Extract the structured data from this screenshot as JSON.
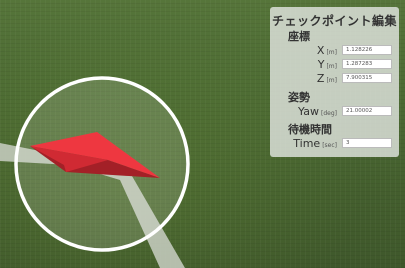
{
  "panel": {
    "title": "チェックポイント編集",
    "position_section": "座標",
    "x": {
      "label": "X",
      "unit": "[m]",
      "value": "1.128226"
    },
    "y": {
      "label": "Y",
      "unit": "[m]",
      "value": "1.287283"
    },
    "z": {
      "label": "Z",
      "unit": "[m]",
      "value": "7.900315"
    },
    "attitude_section": "姿勢",
    "yaw": {
      "label": "Yaw",
      "unit": "[deg]",
      "value": "21.00002"
    },
    "wait_section": "待機時間",
    "time": {
      "label": "Time",
      "unit": "[sec]",
      "value": "3"
    }
  },
  "colors": {
    "marker": "#e8333b",
    "marker_dark": "#9c1e24",
    "ring": "#ffffff",
    "path": "#c9cfc3",
    "grass": "#4c6a33"
  }
}
